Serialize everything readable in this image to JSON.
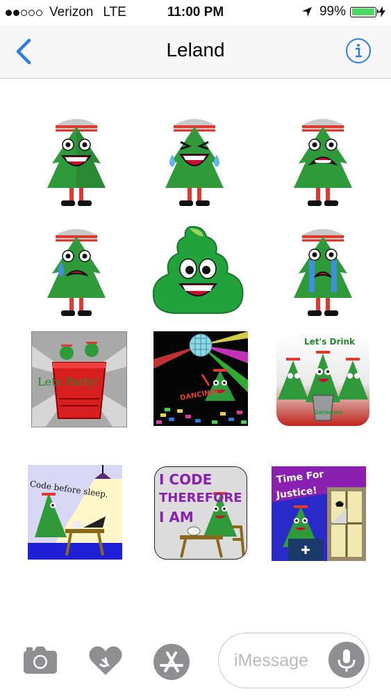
{
  "status_bar": {
    "carrier": "Verizon",
    "network": "LTE",
    "time": "11:00 PM",
    "battery": "99%",
    "battery_level": 0.99,
    "signal_bars": 2,
    "signal_total": 5
  },
  "nav": {
    "title": "Leland"
  },
  "stickers": [
    {
      "id": "tree-smile",
      "kind": "tree",
      "face": "smile"
    },
    {
      "id": "tree-laugh-tears",
      "kind": "tree",
      "face": "laugh-tears"
    },
    {
      "id": "tree-grimace",
      "kind": "tree",
      "face": "grimace"
    },
    {
      "id": "tree-sad-sweat",
      "kind": "tree",
      "face": "sad-sweat"
    },
    {
      "id": "poop-smile",
      "kind": "poop",
      "face": "smile"
    },
    {
      "id": "tree-crying",
      "kind": "tree",
      "face": "crying"
    }
  ],
  "tiles": {
    "party": {
      "text": "Lets Party!"
    },
    "dancing": {
      "text": "DANCING!"
    },
    "drink": {
      "text": "Let's Drink",
      "text2": "Gatorade"
    },
    "code_sleep": {
      "text": "Code before sleep."
    },
    "code_therefore": {
      "line1": "I CODE",
      "line2": "THEREFORE",
      "line3": "I AM"
    },
    "justice": {
      "line1": "Time For",
      "line2": "Justice!"
    }
  },
  "input_bar": {
    "placeholder": "iMessage"
  },
  "colors": {
    "ios_blue": "#2b7de9",
    "tree_green": "#2e9a3a",
    "tree_dark": "#1f6e28",
    "cap_red": "#e03a2e",
    "mouth_red": "#c8102e",
    "purple_text": "#8a1fb0"
  }
}
